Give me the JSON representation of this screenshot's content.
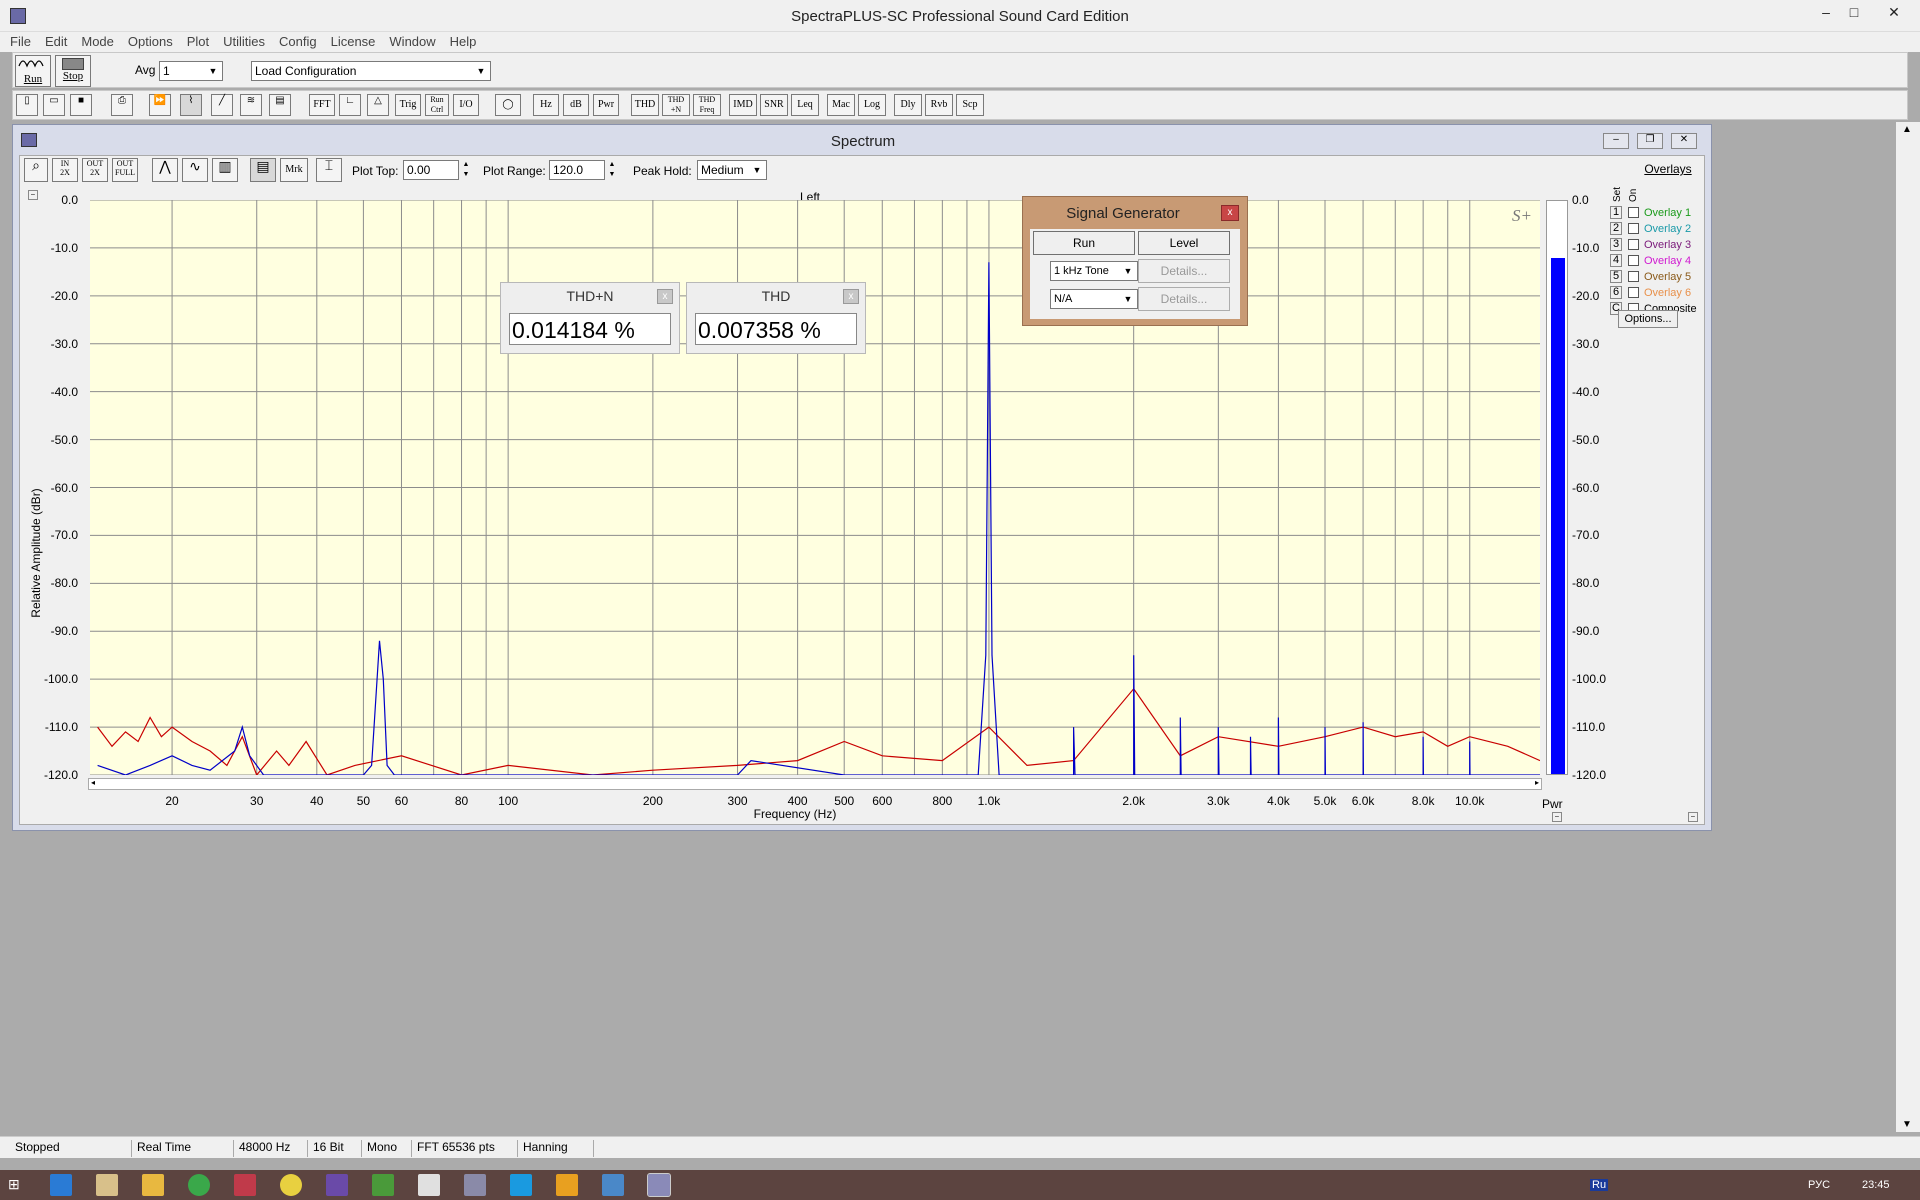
{
  "app": {
    "title": "SpectraPLUS-SC Professional Sound Card Edition",
    "window_controls": [
      "–",
      "□",
      "✕"
    ]
  },
  "menu": [
    "File",
    "Edit",
    "Mode",
    "Options",
    "Plot",
    "Utilities",
    "Config",
    "License",
    "Window",
    "Help"
  ],
  "toolbar1": {
    "run_label": "Run",
    "stop_label": "Stop",
    "avg_label": "Avg",
    "avg_value": "1",
    "config_value": "Load Configuration"
  },
  "toolbar2": [
    "FFT",
    "Trig",
    "Run Ctrl",
    "I/O",
    "Hz",
    "dB",
    "Pwr",
    "THD",
    "THD +N",
    "THD Freq",
    "IMD",
    "SNR",
    "Leq",
    "Mac",
    "Log",
    "Dly",
    "Rvb",
    "Scp"
  ],
  "spectrum_window": {
    "title": "Spectrum",
    "plot_top_label": "Plot Top:",
    "plot_top_value": "0.00",
    "plot_range_label": "Plot Range:",
    "plot_range_value": "120.0",
    "peak_hold_label": "Peak Hold:",
    "peak_hold_value": "Medium",
    "mrk_label": "Mrk",
    "channel_label": "Left",
    "logo": "S+",
    "pwr_label": "Pwr"
  },
  "chart_data": {
    "type": "line",
    "title": "Left",
    "xlabel": "Frequency (Hz)",
    "ylabel": "Relative Amplitude (dBr)",
    "x_scale": "log",
    "xlim": [
      13.5,
      14000
    ],
    "ylim": [
      -120,
      0
    ],
    "x_ticks": [
      "20",
      "30",
      "40",
      "50",
      "60",
      "80",
      "100",
      "200",
      "300",
      "400",
      "500",
      "600",
      "800",
      "1.0k",
      "2.0k",
      "3.0k",
      "4.0k",
      "5.0k",
      "6.0k",
      "8.0k",
      "10.0k"
    ],
    "y_ticks": [
      "0.0",
      "-10.0",
      "-20.0",
      "-30.0",
      "-40.0",
      "-50.0",
      "-60.0",
      "-70.0",
      "-80.0",
      "-90.0",
      "-100.0",
      "-110.0",
      "-120.0"
    ],
    "grid": true,
    "series": [
      {
        "color": "#0000c8",
        "points": [
          [
            14,
            -118
          ],
          [
            16,
            -120
          ],
          [
            18,
            -118
          ],
          [
            20,
            -116
          ],
          [
            22,
            -118
          ],
          [
            24,
            -119
          ],
          [
            27,
            -115
          ],
          [
            28,
            -110
          ],
          [
            29,
            -116
          ],
          [
            31,
            -120
          ],
          [
            40,
            -120
          ],
          [
            50,
            -120
          ],
          [
            52,
            -118
          ],
          [
            54,
            -92
          ],
          [
            55,
            -100
          ],
          [
            56,
            -118
          ],
          [
            58,
            -120
          ],
          [
            100,
            -120
          ],
          [
            300,
            -120
          ],
          [
            320,
            -117
          ],
          [
            500,
            -120
          ],
          [
            700,
            -120
          ],
          [
            950,
            -120
          ],
          [
            985,
            -95
          ],
          [
            1000,
            -13
          ],
          [
            1015,
            -95
          ],
          [
            1050,
            -120
          ],
          [
            1500,
            -120
          ],
          [
            1500,
            -110
          ],
          [
            1510,
            -120
          ],
          [
            2000,
            -120
          ],
          [
            2000,
            -95
          ],
          [
            2010,
            -120
          ],
          [
            2500,
            -120
          ],
          [
            2500,
            -108
          ],
          [
            2510,
            -120
          ],
          [
            3000,
            -120
          ],
          [
            3000,
            -110
          ],
          [
            3010,
            -120
          ],
          [
            3500,
            -120
          ],
          [
            3500,
            -112
          ],
          [
            3510,
            -120
          ],
          [
            4000,
            -120
          ],
          [
            4000,
            -108
          ],
          [
            4010,
            -120
          ],
          [
            5000,
            -120
          ],
          [
            5000,
            -110
          ],
          [
            5010,
            -120
          ],
          [
            6000,
            -120
          ],
          [
            6000,
            -109
          ],
          [
            6010,
            -120
          ],
          [
            8000,
            -120
          ],
          [
            8000,
            -112
          ],
          [
            8010,
            -120
          ],
          [
            10000,
            -120
          ],
          [
            10000,
            -113
          ],
          [
            10010,
            -120
          ],
          [
            14000,
            -120
          ]
        ]
      },
      {
        "color": "#c80000",
        "points": [
          [
            14,
            -110
          ],
          [
            15,
            -114
          ],
          [
            16,
            -111
          ],
          [
            17,
            -113
          ],
          [
            18,
            -108
          ],
          [
            19,
            -112
          ],
          [
            20,
            -110
          ],
          [
            22,
            -113
          ],
          [
            24,
            -115
          ],
          [
            26,
            -118
          ],
          [
            28,
            -112
          ],
          [
            30,
            -120
          ],
          [
            33,
            -115
          ],
          [
            35,
            -118
          ],
          [
            38,
            -113
          ],
          [
            42,
            -120
          ],
          [
            48,
            -118
          ],
          [
            60,
            -116
          ],
          [
            80,
            -120
          ],
          [
            100,
            -118
          ],
          [
            150,
            -120
          ],
          [
            200,
            -119
          ],
          [
            300,
            -118
          ],
          [
            400,
            -117
          ],
          [
            500,
            -113
          ],
          [
            600,
            -116
          ],
          [
            800,
            -117
          ],
          [
            1000,
            -110
          ],
          [
            1200,
            -118
          ],
          [
            1500,
            -117
          ],
          [
            2000,
            -102
          ],
          [
            2500,
            -116
          ],
          [
            3000,
            -112
          ],
          [
            4000,
            -114
          ],
          [
            5000,
            -112
          ],
          [
            6000,
            -110
          ],
          [
            7000,
            -112
          ],
          [
            8000,
            -111
          ],
          [
            9000,
            -114
          ],
          [
            10000,
            -112
          ],
          [
            12000,
            -114
          ],
          [
            14000,
            -117
          ]
        ]
      }
    ],
    "power_meter": {
      "value_db": -12,
      "range": [
        -120,
        0
      ]
    }
  },
  "thd_n_box": {
    "title": "THD+N",
    "value": "0.014184 %"
  },
  "thd_box": {
    "title": "THD",
    "value": "0.007358 %"
  },
  "signal_generator": {
    "title": "Signal Generator",
    "run_label": "Run",
    "level_label": "Level",
    "tone_value": "1 kHz Tone",
    "second_value": "N/A",
    "details_label": "Details..."
  },
  "overlays": {
    "title": "Overlays",
    "col_set": "Set",
    "col_on": "On",
    "items": [
      {
        "num": "1",
        "label": "Overlay 1",
        "color": "#1a9a1a"
      },
      {
        "num": "2",
        "label": "Overlay 2",
        "color": "#1a9aa8"
      },
      {
        "num": "3",
        "label": "Overlay 3",
        "color": "#7a1a7a"
      },
      {
        "num": "4",
        "label": "Overlay 4",
        "color": "#d01ad0"
      },
      {
        "num": "5",
        "label": "Overlay 5",
        "color": "#8a5a1a"
      },
      {
        "num": "6",
        "label": "Overlay 6",
        "color": "#e8904a"
      },
      {
        "num": "C",
        "label": "Composite",
        "color": "#000000"
      }
    ],
    "options_label": "Options..."
  },
  "status_bar": [
    "Stopped",
    "Real Time",
    "48000 Hz",
    "16 Bit",
    "Mono",
    "FFT 65536 pts",
    "Hanning"
  ],
  "taskbar": {
    "lang": "РУС",
    "time": "23:45",
    "tray_icons": [
      "Ru"
    ]
  }
}
